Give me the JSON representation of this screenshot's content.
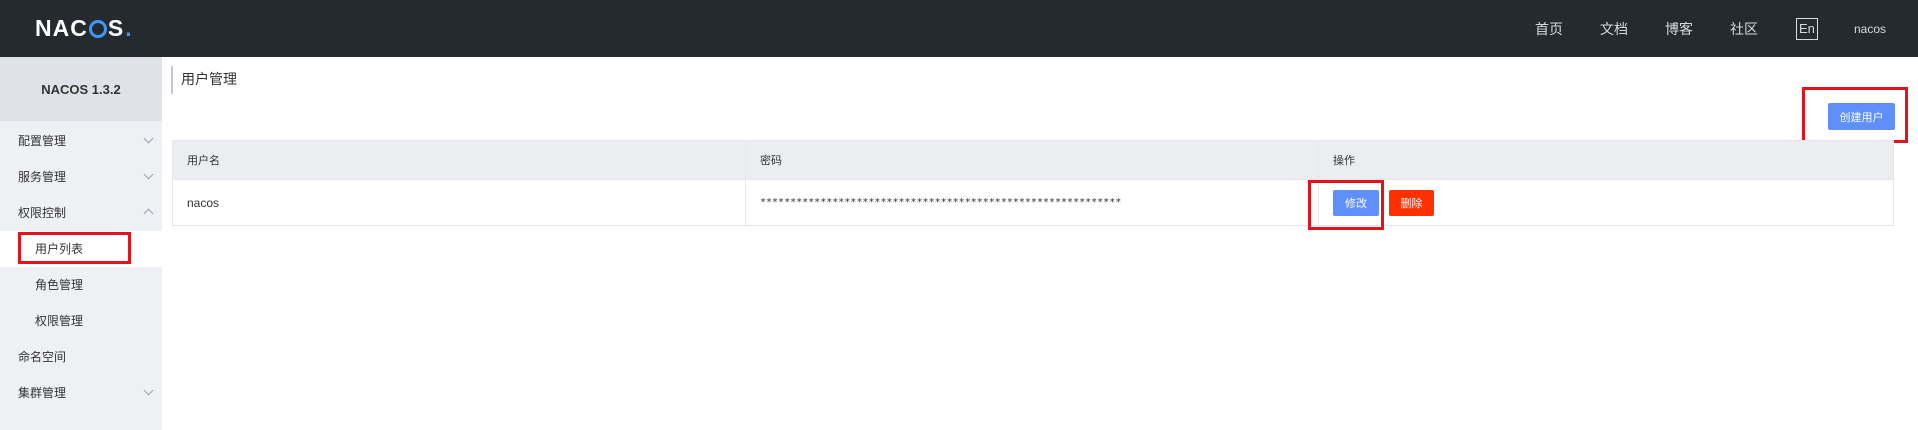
{
  "header": {
    "logo_text": "NACOS.",
    "nav": [
      "首页",
      "文档",
      "博客",
      "社区"
    ],
    "lang_button": "En",
    "username": "nacos"
  },
  "sidebar": {
    "version": "NACOS 1.3.2",
    "items": [
      {
        "label": "配置管理",
        "expanded": false
      },
      {
        "label": "服务管理",
        "expanded": false
      },
      {
        "label": "权限控制",
        "expanded": true
      },
      {
        "label": "用户列表",
        "sub": true,
        "active": true
      },
      {
        "label": "角色管理",
        "sub": true
      },
      {
        "label": "权限管理",
        "sub": true
      },
      {
        "label": "命名空间"
      },
      {
        "label": "集群管理",
        "expanded": false
      }
    ]
  },
  "main": {
    "title": "用户管理",
    "create_button": "创建用户",
    "table": {
      "headers": [
        "用户名",
        "密码",
        "操作"
      ],
      "rows": [
        {
          "username": "nacos",
          "password": "************************************************************",
          "edit_label": "修改",
          "delete_label": "删除"
        }
      ]
    }
  },
  "colors": {
    "header_bg": "#252a2f",
    "primary": "#5f8ffa",
    "danger": "#ff3000",
    "highlight": "#e4131b"
  }
}
